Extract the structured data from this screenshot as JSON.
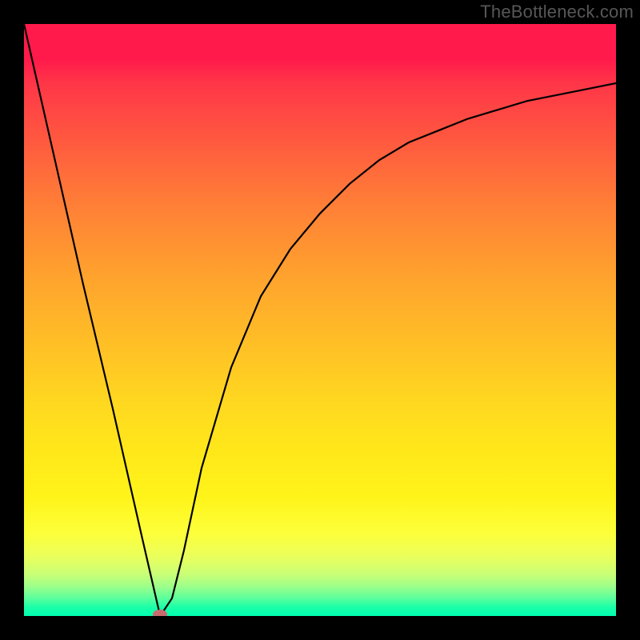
{
  "watermark": "TheBottleneck.com",
  "chart_data": {
    "type": "line",
    "title": "",
    "xlabel": "",
    "ylabel": "",
    "xlim": [
      0,
      100
    ],
    "ylim": [
      0,
      100
    ],
    "grid": false,
    "legend": false,
    "series": [
      {
        "name": "curve",
        "x": [
          0,
          5,
          10,
          15,
          20,
          23,
          25,
          27,
          30,
          35,
          40,
          45,
          50,
          55,
          60,
          65,
          70,
          75,
          80,
          85,
          90,
          95,
          100
        ],
        "y": [
          100,
          78,
          56,
          35,
          13,
          0,
          3,
          11,
          25,
          42,
          54,
          62,
          68,
          73,
          77,
          80,
          82,
          84,
          85.5,
          87,
          88,
          89,
          90
        ]
      }
    ],
    "marker": {
      "x": 23,
      "y": 0
    },
    "background_gradient": {
      "top": "#ff1a4b",
      "bottom": "#00ffb0"
    }
  }
}
